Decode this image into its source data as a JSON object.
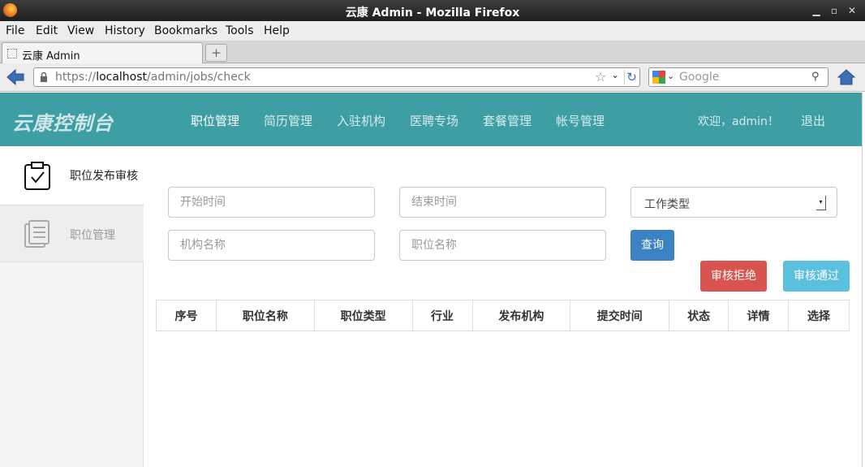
{
  "window": {
    "title": "云康 Admin - Mozilla Firefox",
    "icon": "firefox-icon"
  },
  "menu": [
    "File",
    "Edit",
    "View",
    "History",
    "Bookmarks",
    "Tools",
    "Help"
  ],
  "tab": {
    "label": "云康 Admin"
  },
  "navbar": {
    "url_prefix": "https://",
    "url_host": "localhost",
    "url_path": "/admin/jobs/check",
    "search_placeholder": "Google"
  },
  "app": {
    "brand": "云康控制台",
    "nav": [
      "职位管理",
      "简历管理",
      "入驻机构",
      "医聘专场",
      "套餐管理",
      "帐号管理"
    ],
    "active_nav": "职位管理",
    "welcome": "欢迎，admin！",
    "logout": "退出",
    "accent_color": "#3d9ea3"
  },
  "sidebar": {
    "items": [
      {
        "label": "职位发布审核",
        "icon": "clipboard-check-icon",
        "active": true
      },
      {
        "label": "职位管理",
        "icon": "document-list-icon",
        "active": false
      }
    ]
  },
  "filters": {
    "start_time_placeholder": "开始时间",
    "end_time_placeholder": "结束时间",
    "job_type_value": "工作类型",
    "org_name_placeholder": "机构名称",
    "job_name_placeholder": "职位名称",
    "query_label": "查询"
  },
  "actions": {
    "reject_label": "审核拒绝",
    "approve_label": "审核通过"
  },
  "table": {
    "columns": [
      "序号",
      "职位名称",
      "职位类型",
      "行业",
      "发布机构",
      "提交时间",
      "状态",
      "详情",
      "选择"
    ],
    "rows": []
  }
}
